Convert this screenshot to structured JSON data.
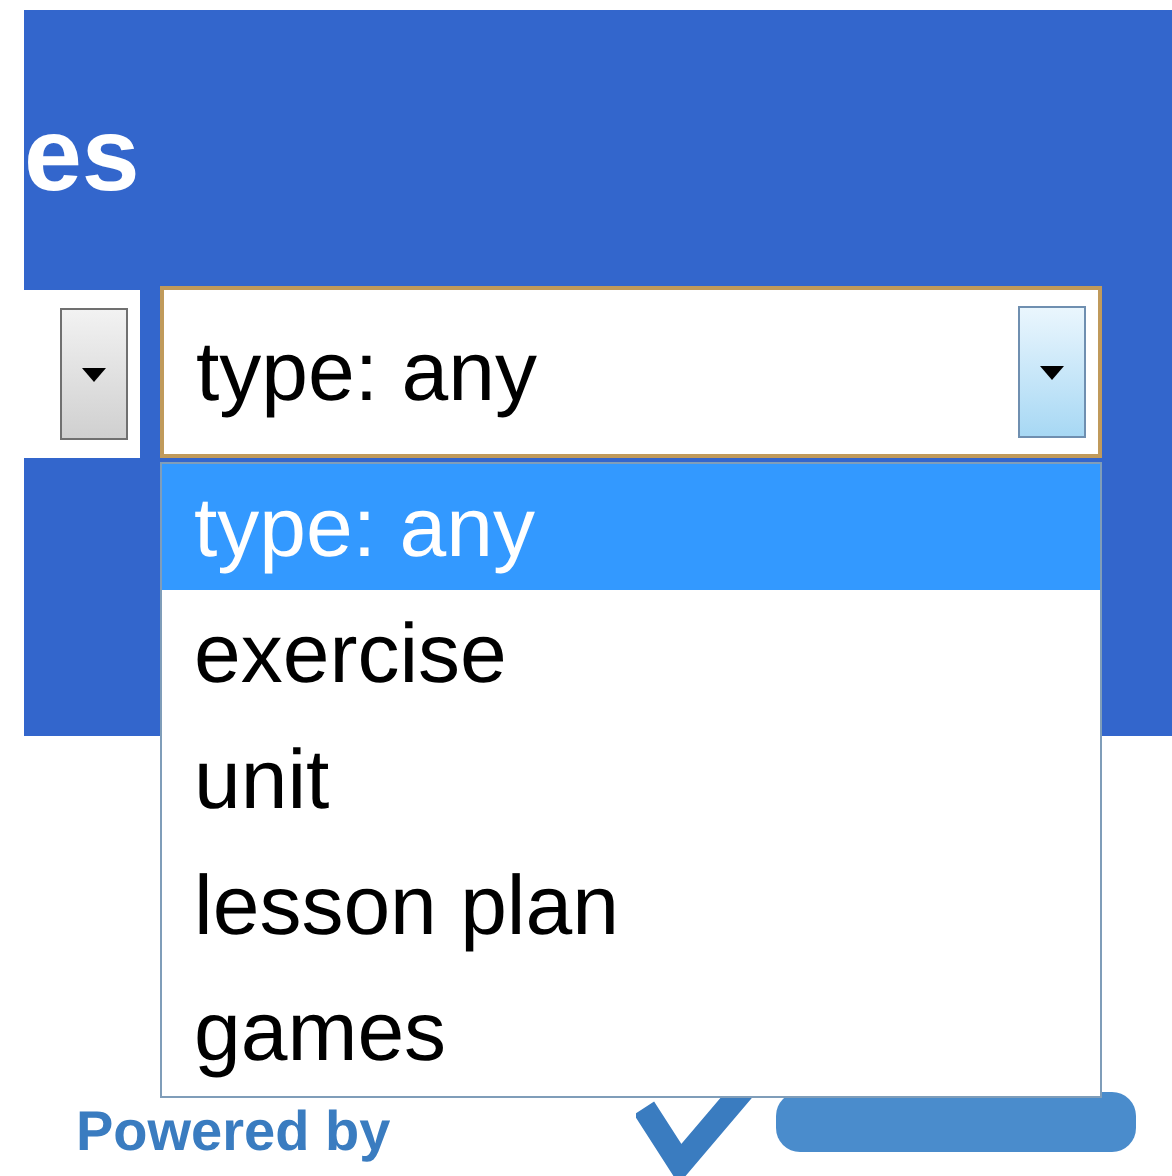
{
  "heading": "es",
  "type_select": {
    "value": "type: any",
    "expanded": true,
    "options": [
      {
        "label": "type: any",
        "selected": true
      },
      {
        "label": "exercise",
        "selected": false
      },
      {
        "label": "unit",
        "selected": false
      },
      {
        "label": "lesson plan",
        "selected": false
      },
      {
        "label": "games",
        "selected": false
      }
    ]
  },
  "footer": {
    "text": "Powered by"
  }
}
